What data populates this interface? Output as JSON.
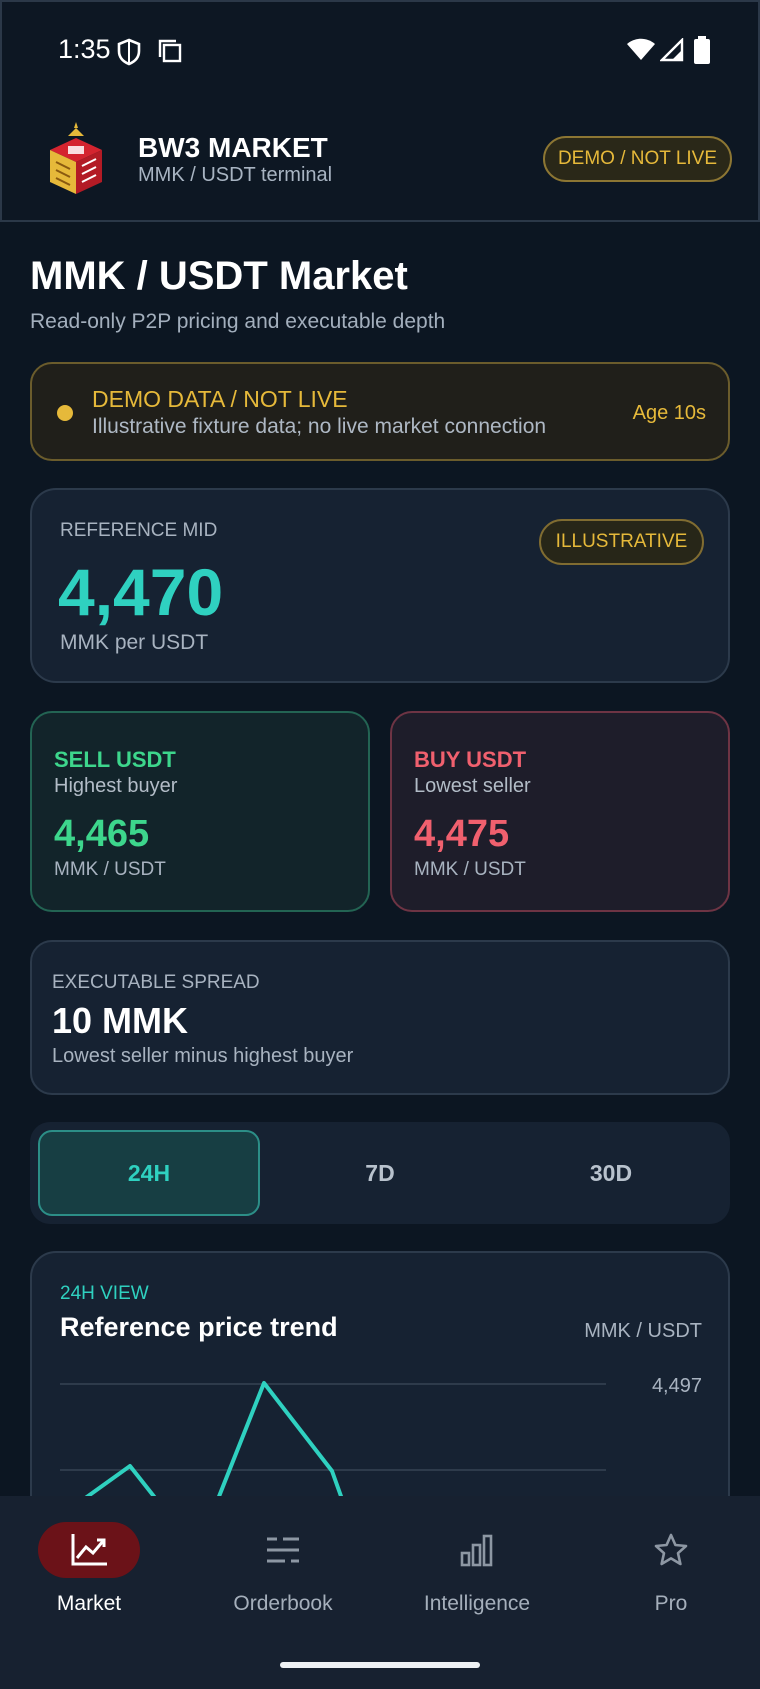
{
  "status_bar": {
    "time": "1:35",
    "icons": [
      "shield-icon",
      "copy-icon",
      "wifi-icon",
      "signal-icon",
      "battery-icon"
    ]
  },
  "header": {
    "brand_title": "BW3 MARKET",
    "brand_subtitle": "MMK / USDT terminal",
    "demo_badge": "DEMO / NOT LIVE"
  },
  "page": {
    "title": "MMK / USDT Market",
    "subtitle": "Read-only P2P pricing and executable depth"
  },
  "banner": {
    "title": "DEMO DATA / NOT LIVE",
    "text": "Illustrative fixture data; no live market connection",
    "age": "Age 10s"
  },
  "reference": {
    "label": "REFERENCE MID",
    "value": "4,470",
    "unit": "MMK per USDT",
    "badge": "ILLUSTRATIVE"
  },
  "sell": {
    "title": "SELL USDT",
    "subtitle": "Highest buyer",
    "value": "4,465",
    "unit": "MMK / USDT"
  },
  "buy": {
    "title": "BUY USDT",
    "subtitle": "Lowest seller",
    "value": "4,475",
    "unit": "MMK / USDT"
  },
  "spread": {
    "label": "EXECUTABLE SPREAD",
    "value": "10 MMK",
    "subtitle": "Lowest seller minus highest buyer"
  },
  "range_tabs": [
    {
      "label": "24H",
      "active": true
    },
    {
      "label": "7D",
      "active": false
    },
    {
      "label": "30D",
      "active": false
    }
  ],
  "trend": {
    "kicker": "24H VIEW",
    "title": "Reference price trend",
    "unit": "MMK / USDT",
    "max_label": "4,497"
  },
  "colors": {
    "accent_teal": "#2fd1c0",
    "sell_green": "#3dd68c",
    "buy_red": "#f0606e",
    "demo_amber": "#e6b93a",
    "nav_active": "#6b1218"
  },
  "bottom_nav": [
    {
      "label": "Market",
      "icon": "chart-line-icon",
      "active": true
    },
    {
      "label": "Orderbook",
      "icon": "list-icon",
      "active": false
    },
    {
      "label": "Intelligence",
      "icon": "bar-chart-icon",
      "active": false
    },
    {
      "label": "Pro",
      "icon": "star-icon",
      "active": false
    }
  ]
}
